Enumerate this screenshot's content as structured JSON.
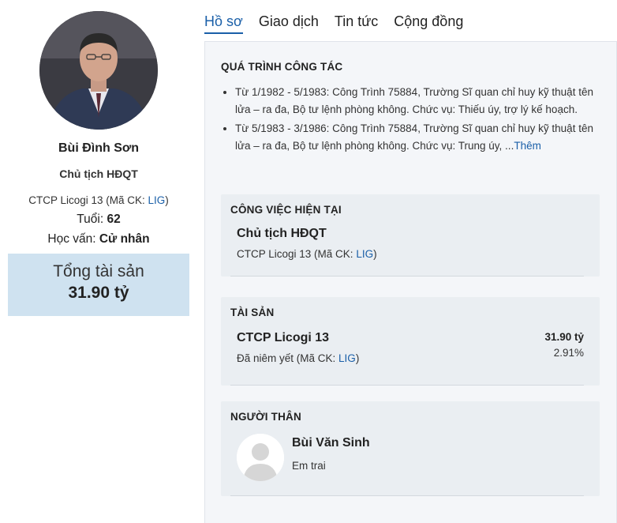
{
  "profile": {
    "name": "Bùi Đình Sơn",
    "position": "Chủ tịch HĐQT",
    "company_name": "CTCP Licogi 13",
    "ticker_prefix": " (Mã CK: ",
    "ticker": "LIG",
    "ticker_suffix": ")",
    "age_label": "Tuổi: ",
    "age": "62",
    "education_label": "Học vấn: ",
    "education": "Cử nhân",
    "total_assets_label": "Tổng tài sản",
    "total_assets_value": "31.90 tỷ"
  },
  "tabs": [
    {
      "label": "Hồ sơ",
      "active": true
    },
    {
      "label": "Giao dịch",
      "active": false
    },
    {
      "label": "Tin tức",
      "active": false
    },
    {
      "label": "Cộng đồng",
      "active": false
    }
  ],
  "career": {
    "title": "QUÁ TRÌNH CÔNG TÁC",
    "items": [
      "Từ 1/1982 - 5/1983: Công Trình 75884, Trường Sĩ quan chỉ huy kỹ thuật tên lửa – ra đa, Bộ tư lệnh phòng không. Chức vụ: Thiếu úy, trợ lý kế hoạch.",
      "Từ 5/1983 - 3/1986: Công Trình 75884, Trường Sĩ quan chỉ huy kỹ thuật tên lửa – ra đa, Bộ tư lệnh phòng không. Chức vụ: Trung úy, ..."
    ],
    "more_label": "Thêm"
  },
  "current_job": {
    "title": "CÔNG VIỆC HIỆN TẠI",
    "job_title": "Chủ tịch HĐQT",
    "company_name": "CTCP Licogi 13",
    "ticker_prefix": " (Mã CK: ",
    "ticker": "LIG",
    "ticker_suffix": ")"
  },
  "assets": {
    "title": "TÀI SẢN",
    "company_name": "CTCP Licogi 13",
    "status_prefix": "Đã niêm yết (Mã CK: ",
    "ticker": "LIG",
    "status_suffix": ")",
    "value": "31.90 tỷ",
    "percent": "2.91%"
  },
  "relatives": {
    "title": "NGƯỜI THÂN",
    "items": [
      {
        "name": "Bùi Văn Sinh",
        "relation": "Em trai"
      }
    ]
  },
  "colors": {
    "link": "#1a5fa8",
    "assets_box": "#cfe2f0",
    "panel_bg": "#f4f6f9",
    "card_bg": "#eaeef2"
  }
}
